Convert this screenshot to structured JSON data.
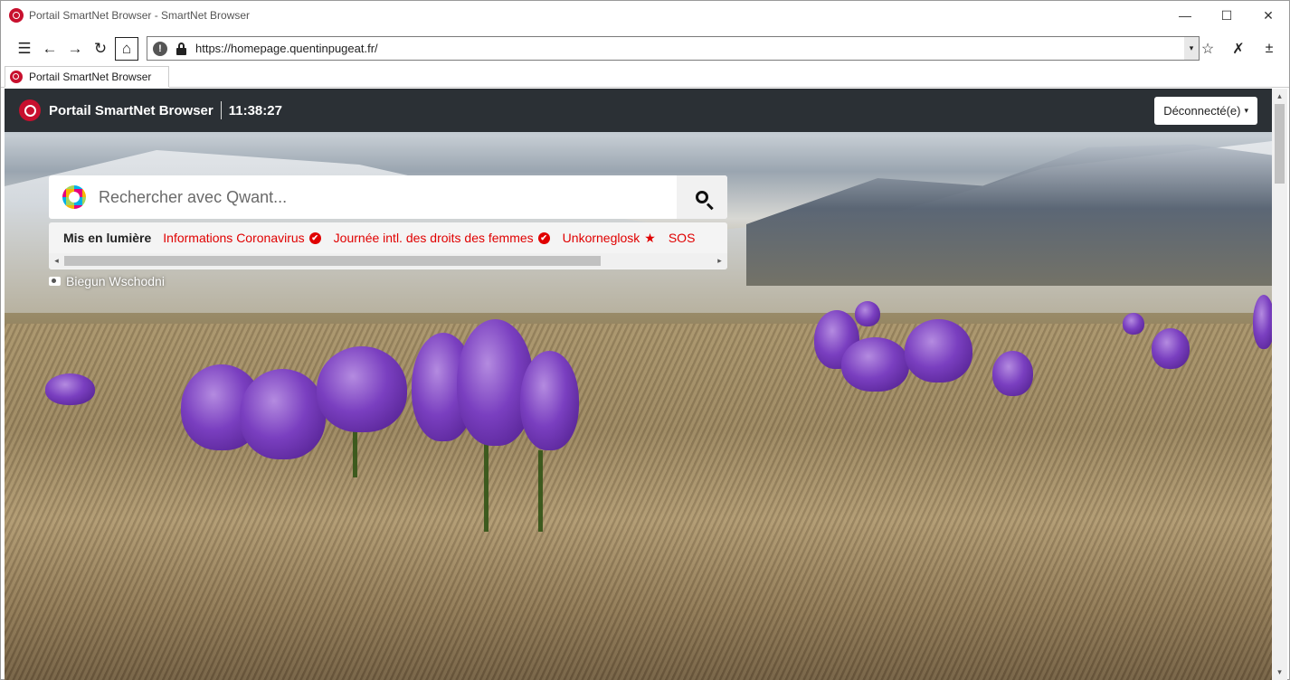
{
  "window": {
    "title": "Portail SmartNet Browser - SmartNet Browser",
    "controls": {
      "minimize": "—",
      "maximize": "☐",
      "close": "✕"
    }
  },
  "nav": {
    "menu_icon": "☰",
    "back_icon": "←",
    "forward_icon": "→",
    "reload_icon": "↻",
    "home_icon": "⌂",
    "info_icon": "!",
    "url": "https://homepage.quentinpugeat.fr/",
    "dropdown_icon": "▾",
    "bookmark_icon": "☆",
    "tool1_icon": "✗",
    "tool2_icon": "±"
  },
  "tab": {
    "label": "Portail SmartNet Browser"
  },
  "page": {
    "header": {
      "title": "Portail SmartNet Browser",
      "clock": "11:38:27",
      "user_button": "Déconnecté(e)",
      "caret": "▾"
    },
    "search": {
      "placeholder": "Rechercher avec Qwant..."
    },
    "featured": {
      "label": "Mis en lumière",
      "items": [
        {
          "text": "Informations Coronavirus",
          "badge": "✔"
        },
        {
          "text": "Journée intl. des droits des femmes",
          "badge": "✔"
        },
        {
          "text": "Unkorneglosk",
          "badge": "★"
        },
        {
          "text": "SOS",
          "badge": ""
        }
      ],
      "scroll_left": "◂",
      "scroll_right": "▸"
    },
    "photo_credit": "Biegun Wschodni"
  },
  "scrollbar": {
    "up": "▴",
    "down": "▾"
  },
  "colors": {
    "accent": "#c8102e",
    "header_bg": "#2b3035",
    "featured_link": "#e00000"
  }
}
